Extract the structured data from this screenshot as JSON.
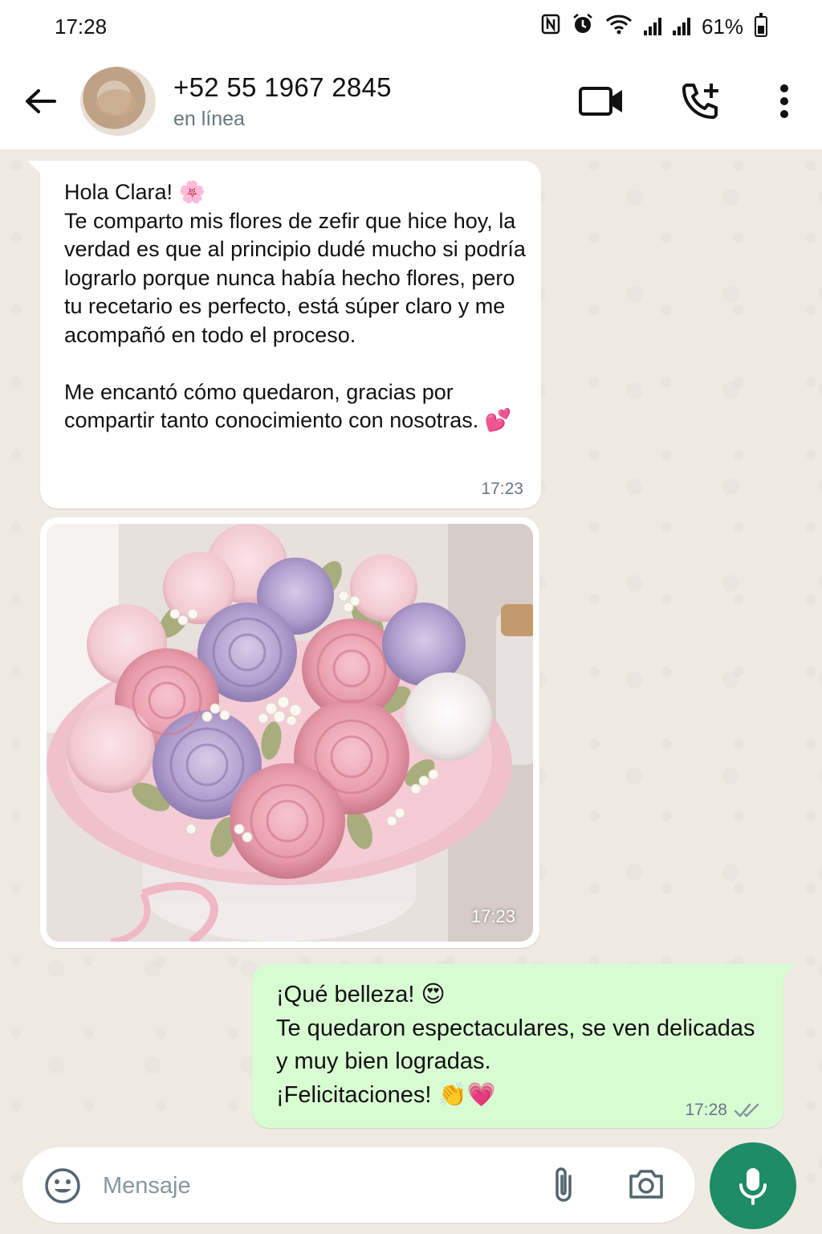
{
  "status_bar": {
    "time": "17:28",
    "battery": "61%"
  },
  "header": {
    "contact_name": "+52 55 1967 2845",
    "contact_status": "en línea",
    "icons": [
      "back-arrow-icon",
      "video-call-icon",
      "add-call-icon",
      "more-vert-icon"
    ]
  },
  "messages": [
    {
      "direction": "in",
      "text": "Hola Clara! 🌸\nTe comparto mis flores de zefir que hice hoy, la verdad es que al principio dudé mucho si podría lograrlo porque nunca había hecho flores, pero tu recetario es perfecto, está súper claro y me acompañó en todo el proceso.\n\nMe encantó cómo quedaron, gracias por compartir tanto conocimiento con nosotras. 💕",
      "time": "17:23"
    },
    {
      "direction": "in",
      "type": "image",
      "time": "17:23"
    },
    {
      "direction": "out",
      "text": "¡Qué belleza! 😍\nTe quedaron espectaculares, se ven delicadas y muy bien logradas.\n¡Felicitaciones! 👏💗",
      "time": "17:28",
      "status": "read"
    }
  ],
  "composer": {
    "placeholder": "Mensaje"
  },
  "colors": {
    "incoming_bubble": "#ffffff",
    "outgoing_bubble": "#d9fdd3",
    "chat_background": "#efeae2",
    "mic_button": "#1e8c66",
    "meta_text": "#667781"
  }
}
